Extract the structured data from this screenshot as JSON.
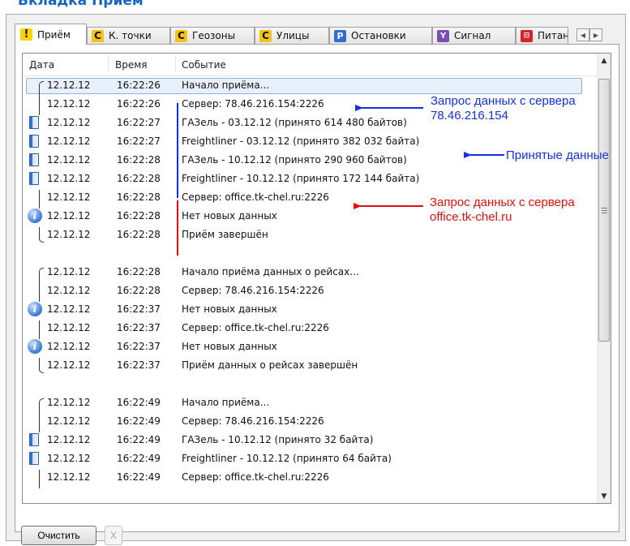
{
  "page": {
    "heading": "Вкладка Приём"
  },
  "tabs": [
    {
      "label": "Приём",
      "icon": "exclamation-icon",
      "glyph": "!",
      "active": true
    },
    {
      "label": "К. точки",
      "icon": "c-letter-icon",
      "glyph": "C"
    },
    {
      "label": "Геозоны",
      "icon": "c-letter-icon",
      "glyph": "C"
    },
    {
      "label": "Улицы",
      "icon": "c-letter-icon",
      "glyph": "C"
    },
    {
      "label": "Остановки",
      "icon": "parking-icon",
      "glyph": "P"
    },
    {
      "label": "Сигнал",
      "icon": "antenna-icon",
      "glyph": "Y"
    },
    {
      "label": "Питан",
      "icon": "power-icon",
      "glyph": "⊟"
    }
  ],
  "tab_scroll": {
    "left": "◀",
    "right": "▶"
  },
  "log": {
    "columns": {
      "date": "Дата",
      "time": "Время",
      "event": "Событие"
    },
    "rows": [
      {
        "date": "12.12.12",
        "time": "16:22:26",
        "event": "Начало приёма...",
        "marker": "bracket-start",
        "selected": true
      },
      {
        "date": "12.12.12",
        "time": "16:22:26",
        "event": "Сервер: 78.46.216.154:2226",
        "marker": "bracket-mid"
      },
      {
        "date": "12.12.12",
        "time": "16:22:27",
        "event": "ГАЗель - 03.12.12 (принято 614 480 байтов)",
        "marker": "doc"
      },
      {
        "date": "12.12.12",
        "time": "16:22:27",
        "event": "Freightliner - 03.12.12 (принято 382 032 байта)",
        "marker": "doc"
      },
      {
        "date": "12.12.12",
        "time": "16:22:28",
        "event": "ГАЗель - 10.12.12 (принято 290 960 байтов)",
        "marker": "doc"
      },
      {
        "date": "12.12.12",
        "time": "16:22:28",
        "event": "Freightliner - 10.12.12 (принято 172 144 байта)",
        "marker": "doc"
      },
      {
        "date": "12.12.12",
        "time": "16:22:28",
        "event": "Сервер: office.tk-chel.ru:2226",
        "marker": "bracket-mid"
      },
      {
        "date": "12.12.12",
        "time": "16:22:28",
        "event": "Нет новых данных",
        "marker": "info"
      },
      {
        "date": "12.12.12",
        "time": "16:22:28",
        "event": "Приём завершён",
        "marker": "bracket-end"
      },
      {
        "date": "",
        "time": "",
        "event": "",
        "marker": "blank"
      },
      {
        "date": "12.12.12",
        "time": "16:22:28",
        "event": "Начало приёма данных о рейсах...",
        "marker": "bracket-start"
      },
      {
        "date": "12.12.12",
        "time": "16:22:28",
        "event": "Сервер: 78.46.216.154:2226",
        "marker": "bracket-mid"
      },
      {
        "date": "12.12.12",
        "time": "16:22:37",
        "event": "Нет новых данных",
        "marker": "info"
      },
      {
        "date": "12.12.12",
        "time": "16:22:37",
        "event": "Сервер: office.tk-chel.ru:2226",
        "marker": "bracket-mid"
      },
      {
        "date": "12.12.12",
        "time": "16:22:37",
        "event": "Нет новых данных",
        "marker": "info"
      },
      {
        "date": "12.12.12",
        "time": "16:22:37",
        "event": "Приём данных о рейсах завершён",
        "marker": "bracket-end"
      },
      {
        "date": "",
        "time": "",
        "event": "",
        "marker": "blank"
      },
      {
        "date": "12.12.12",
        "time": "16:22:49",
        "event": "Начало приёма...",
        "marker": "bracket-start"
      },
      {
        "date": "12.12.12",
        "time": "16:22:49",
        "event": "Сервер: 78.46.216.154:2226",
        "marker": "bracket-mid"
      },
      {
        "date": "12.12.12",
        "time": "16:22:49",
        "event": "ГАЗель - 10.12.12 (принято 32 байта)",
        "marker": "doc"
      },
      {
        "date": "12.12.12",
        "time": "16:22:49",
        "event": "Freightliner - 10.12.12 (принято 64 байта)",
        "marker": "doc"
      },
      {
        "date": "12.12.12",
        "time": "16:22:49",
        "event": "Сервер: office.tk-chel.ru:2226",
        "marker": "bracket-mid"
      }
    ]
  },
  "annotations": {
    "server1_line1": "Запрос данных с сервера",
    "server1_line2": "78.46.216.154",
    "received": "Принятые данные",
    "server2_line1": "Запрос данных с сервера",
    "server2_line2": "office.tk-chel.ru",
    "blue_color": "#1530e0",
    "red_color": "#e01010"
  },
  "buttons": {
    "clear": "Очистить",
    "close": "X"
  }
}
